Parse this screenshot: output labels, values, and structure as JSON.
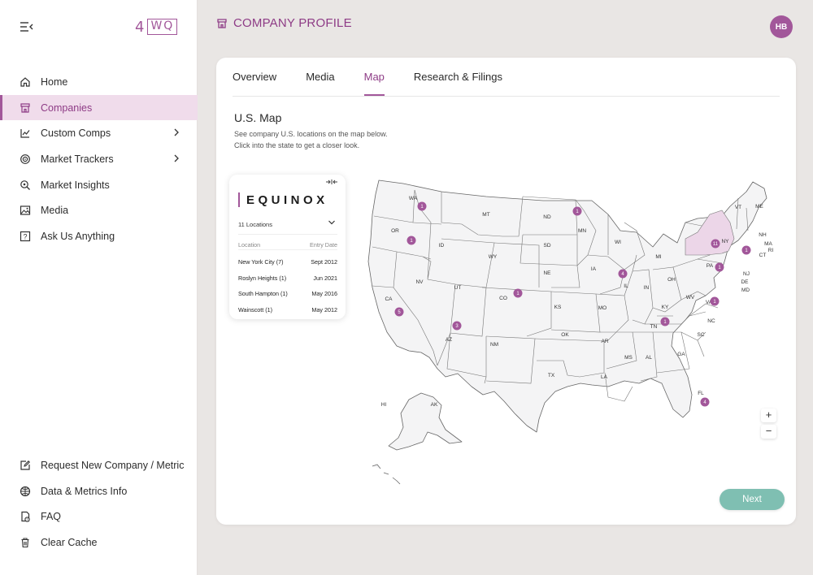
{
  "brand": {
    "logo_num": "4",
    "logo_box": "WQ"
  },
  "sidebar": {
    "items": [
      {
        "label": "Home",
        "icon": "home-icon"
      },
      {
        "label": "Companies",
        "icon": "building-icon",
        "active": true
      },
      {
        "label": "Custom Comps",
        "icon": "chart-line-icon",
        "chevron": true
      },
      {
        "label": "Market Trackers",
        "icon": "target-icon",
        "chevron": true
      },
      {
        "label": "Market Insights",
        "icon": "search-insight-icon"
      },
      {
        "label": "Media",
        "icon": "image-icon"
      },
      {
        "label": "Ask Us Anything",
        "icon": "question-icon"
      }
    ],
    "bottom": [
      {
        "label": "Request New Company / Metric",
        "icon": "edit-icon"
      },
      {
        "label": "Data & Metrics Info",
        "icon": "database-icon"
      },
      {
        "label": "FAQ",
        "icon": "faq-icon"
      },
      {
        "label": "Clear Cache",
        "icon": "trash-icon"
      }
    ]
  },
  "header": {
    "title": "COMPANY PROFILE",
    "avatar": "HB"
  },
  "tabs": [
    {
      "label": "Overview"
    },
    {
      "label": "Media"
    },
    {
      "label": "Map",
      "active": true
    },
    {
      "label": "Research & Filings"
    }
  ],
  "map_section": {
    "heading": "U.S. Map",
    "desc1": "See company U.S. locations on the map below.",
    "desc2": "Click into the state to get a closer look."
  },
  "company": {
    "name": "EQUINOX",
    "locations_count": "11 Locations",
    "col_location": "Location",
    "col_entry": "Entry Date",
    "locations": [
      {
        "location": "New York City (7)",
        "date": "Sept 2012"
      },
      {
        "location": "Roslyn Heights (1)",
        "date": "Jun 2021"
      },
      {
        "location": "South Hampton (1)",
        "date": "May 2016"
      },
      {
        "location": "Wainscott (1)",
        "date": "May 2012"
      }
    ]
  },
  "map": {
    "state_labels": [
      "WA",
      "OR",
      "CA",
      "ID",
      "NV",
      "MT",
      "WY",
      "UT",
      "AZ",
      "CO",
      "NM",
      "ND",
      "SD",
      "NE",
      "KS",
      "OK",
      "TX",
      "MN",
      "IA",
      "MO",
      "AR",
      "LA",
      "WI",
      "IL",
      "MI",
      "IN",
      "OH",
      "KY",
      "TN",
      "MS",
      "AL",
      "GA",
      "FL",
      "SC",
      "NC",
      "VA",
      "WV",
      "PA",
      "NY",
      "VT",
      "NH",
      "ME",
      "MA",
      "RI",
      "CT",
      "NJ",
      "DE",
      "MD",
      "AK",
      "HI"
    ],
    "markers": [
      "1",
      "1",
      "5",
      "3",
      "1",
      "1",
      "4",
      "11",
      "1",
      "1",
      "1",
      "1",
      "4"
    ],
    "accent_color": "#a2579a",
    "highlight_color": "#ecd6e8"
  },
  "zoom": {
    "in": "+",
    "out": "−"
  },
  "next_label": "Next"
}
